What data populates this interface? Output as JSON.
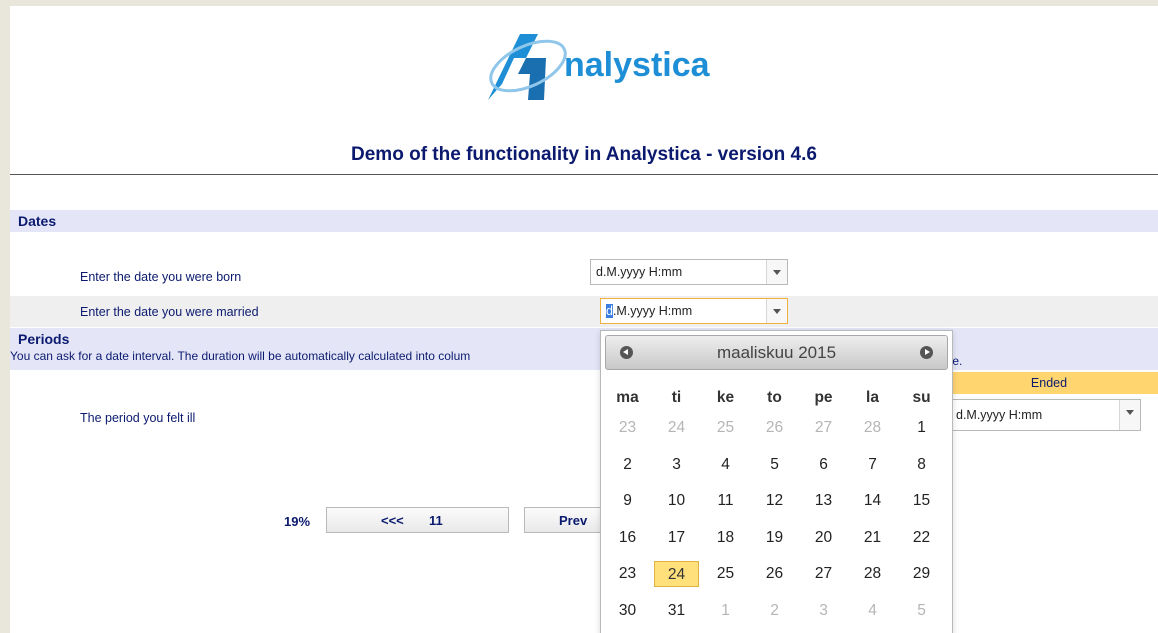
{
  "brand": {
    "logo_text": "nalystica"
  },
  "title": "Demo of the functionality in Analystica - version 4.6",
  "sections": {
    "dates": {
      "label": "Dates",
      "rows": [
        {
          "label": "Enter the date you were born",
          "value": "d.M.yyyy H:mm"
        },
        {
          "label": "Enter the date you were married",
          "value_first": "d",
          "value_rest": ".M.yyyy H:mm"
        }
      ]
    },
    "periods": {
      "label": "Periods",
      "help_start": "You can ask for a date interval. The duration will be automatically calculated into colum",
      "help_end": "lue.",
      "ended_header": "Ended",
      "row": {
        "label": "The period you felt ill",
        "ended_value": "d.M.yyyy H:mm"
      }
    }
  },
  "pager": {
    "percent": "19%",
    "back_arrows": "<<<",
    "back_page": "11",
    "prev_label": "Prev"
  },
  "calendar": {
    "month_label": "maaliskuu 2015",
    "weekdays": [
      "ma",
      "ti",
      "ke",
      "to",
      "pe",
      "la",
      "su"
    ],
    "weeks": [
      [
        {
          "d": "23",
          "m": true
        },
        {
          "d": "24",
          "m": true
        },
        {
          "d": "25",
          "m": true
        },
        {
          "d": "26",
          "m": true
        },
        {
          "d": "27",
          "m": true
        },
        {
          "d": "28",
          "m": true
        },
        {
          "d": "1"
        }
      ],
      [
        {
          "d": "2"
        },
        {
          "d": "3"
        },
        {
          "d": "4"
        },
        {
          "d": "5"
        },
        {
          "d": "6"
        },
        {
          "d": "7"
        },
        {
          "d": "8"
        }
      ],
      [
        {
          "d": "9"
        },
        {
          "d": "10"
        },
        {
          "d": "11"
        },
        {
          "d": "12"
        },
        {
          "d": "13"
        },
        {
          "d": "14"
        },
        {
          "d": "15"
        }
      ],
      [
        {
          "d": "16"
        },
        {
          "d": "17"
        },
        {
          "d": "18"
        },
        {
          "d": "19"
        },
        {
          "d": "20"
        },
        {
          "d": "21"
        },
        {
          "d": "22"
        }
      ],
      [
        {
          "d": "23"
        },
        {
          "d": "24",
          "today": true
        },
        {
          "d": "25"
        },
        {
          "d": "26"
        },
        {
          "d": "27"
        },
        {
          "d": "28"
        },
        {
          "d": "29"
        }
      ],
      [
        {
          "d": "30"
        },
        {
          "d": "31"
        },
        {
          "d": "1",
          "m": true
        },
        {
          "d": "2",
          "m": true
        },
        {
          "d": "3",
          "m": true
        },
        {
          "d": "4",
          "m": true
        },
        {
          "d": "5",
          "m": true
        }
      ]
    ]
  },
  "colors": {
    "brand_blue": "#1e8fd6",
    "text_navy": "#0b1a6e",
    "section_band": "#e4e6f8",
    "highlight": "#ffe07a"
  }
}
